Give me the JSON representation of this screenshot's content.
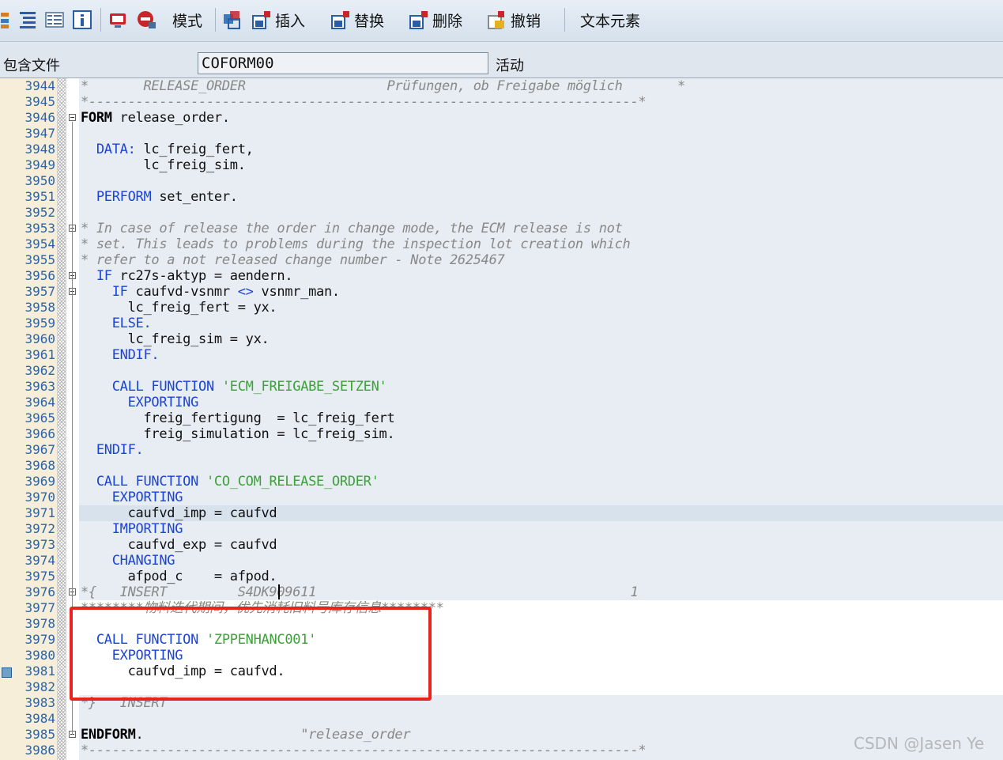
{
  "toolbar": {
    "mode_label": "模式",
    "insert_label": "插入",
    "replace_label": "替换",
    "delete_label": "删除",
    "undo_label": "撤销",
    "text_element_label": "文本元素"
  },
  "include": {
    "label": "包含文件",
    "program": "COFORM00",
    "status": "活动"
  },
  "lines": [
    {
      "n": "3944",
      "parts": [
        {
          "t": "*       RELEASE_ORDER                  Prüfungen, ob Freigabe möglich       *",
          "c": "com"
        }
      ]
    },
    {
      "n": "3945",
      "parts": [
        {
          "t": "*----------------------------------------------------------------------*",
          "c": "com"
        }
      ]
    },
    {
      "n": "3946",
      "parts": [
        {
          "t": "FORM",
          "c": "bold"
        },
        {
          "t": " release_order.",
          "c": ""
        }
      ]
    },
    {
      "n": "3947",
      "parts": []
    },
    {
      "n": "3948",
      "parts": [
        {
          "t": "  DATA:",
          "c": "kw"
        },
        {
          "t": " lc_freig_fert,",
          "c": ""
        }
      ]
    },
    {
      "n": "3949",
      "parts": [
        {
          "t": "        lc_freig_sim.",
          "c": ""
        }
      ]
    },
    {
      "n": "3950",
      "parts": []
    },
    {
      "n": "3951",
      "parts": [
        {
          "t": "  PERFORM",
          "c": "kw"
        },
        {
          "t": " set_enter.",
          "c": ""
        }
      ]
    },
    {
      "n": "3952",
      "parts": []
    },
    {
      "n": "3953",
      "parts": [
        {
          "t": "* In case of release the order in change mode, the ECM release is not",
          "c": "com"
        }
      ]
    },
    {
      "n": "3954",
      "parts": [
        {
          "t": "* set. This leads to problems during the inspection lot creation which",
          "c": "com"
        }
      ]
    },
    {
      "n": "3955",
      "parts": [
        {
          "t": "* refer to a not released change number - Note 2625467",
          "c": "com"
        }
      ]
    },
    {
      "n": "3956",
      "parts": [
        {
          "t": "  IF",
          "c": "kw"
        },
        {
          "t": " rc27s-aktyp = aendern.",
          "c": ""
        }
      ]
    },
    {
      "n": "3957",
      "parts": [
        {
          "t": "    IF",
          "c": "kw"
        },
        {
          "t": " caufvd-vsnmr ",
          "c": ""
        },
        {
          "t": "<>",
          "c": "kw"
        },
        {
          "t": " vsnmr_man.",
          "c": ""
        }
      ]
    },
    {
      "n": "3958",
      "parts": [
        {
          "t": "      lc_freig_fert = yx.",
          "c": ""
        }
      ]
    },
    {
      "n": "3959",
      "parts": [
        {
          "t": "    ELSE.",
          "c": "kw"
        }
      ]
    },
    {
      "n": "3960",
      "parts": [
        {
          "t": "      lc_freig_sim = yx.",
          "c": ""
        }
      ]
    },
    {
      "n": "3961",
      "parts": [
        {
          "t": "    ENDIF.",
          "c": "kw"
        }
      ]
    },
    {
      "n": "3962",
      "parts": []
    },
    {
      "n": "3963",
      "parts": [
        {
          "t": "    CALL FUNCTION",
          "c": "kw"
        },
        {
          "t": " 'ECM_FREIGABE_SETZEN'",
          "c": "str"
        }
      ]
    },
    {
      "n": "3964",
      "parts": [
        {
          "t": "      EXPORTING",
          "c": "kw"
        }
      ]
    },
    {
      "n": "3965",
      "parts": [
        {
          "t": "        freig_fertigung  = lc_freig_fert",
          "c": ""
        }
      ]
    },
    {
      "n": "3966",
      "parts": [
        {
          "t": "        freig_simulation = lc_freig_sim.",
          "c": ""
        }
      ]
    },
    {
      "n": "3967",
      "parts": [
        {
          "t": "  ENDIF.",
          "c": "kw"
        }
      ]
    },
    {
      "n": "3968",
      "parts": []
    },
    {
      "n": "3969",
      "parts": [
        {
          "t": "  CALL FUNCTION",
          "c": "kw"
        },
        {
          "t": " 'CO_COM_RELEASE_ORDER'",
          "c": "str"
        }
      ]
    },
    {
      "n": "3970",
      "parts": [
        {
          "t": "    EXPORTING",
          "c": "kw"
        }
      ]
    },
    {
      "n": "3971",
      "parts": [
        {
          "t": "      caufvd_imp = caufvd",
          "c": ""
        }
      ]
    },
    {
      "n": "3972",
      "parts": [
        {
          "t": "    IMPORTING",
          "c": "kw"
        }
      ]
    },
    {
      "n": "3973",
      "parts": [
        {
          "t": "      caufvd_exp = caufvd",
          "c": ""
        }
      ]
    },
    {
      "n": "3974",
      "parts": [
        {
          "t": "    CHANGING",
          "c": "kw"
        }
      ]
    },
    {
      "n": "3975",
      "parts": [
        {
          "t": "      afpod_c    = afpod.",
          "c": ""
        }
      ]
    },
    {
      "n": "3976",
      "parts": [
        {
          "t": "*{   INSERT         S4DK909611                                        1",
          "c": "com"
        }
      ]
    },
    {
      "n": "3977",
      "parts": [
        {
          "t": "********物料迭代期间，优先消耗旧料号库存信息********",
          "c": "com"
        }
      ]
    },
    {
      "n": "3978",
      "parts": []
    },
    {
      "n": "3979",
      "parts": [
        {
          "t": "  CALL FUNCTION",
          "c": "kw"
        },
        {
          "t": " 'ZPPENHANC001'",
          "c": "str"
        }
      ]
    },
    {
      "n": "3980",
      "parts": [
        {
          "t": "    EXPORTING",
          "c": "kw"
        }
      ]
    },
    {
      "n": "3981",
      "parts": [
        {
          "t": "      caufvd_imp = caufvd.",
          "c": ""
        }
      ]
    },
    {
      "n": "3982",
      "parts": []
    },
    {
      "n": "3983",
      "parts": [
        {
          "t": "*}   INSERT",
          "c": "com"
        }
      ]
    },
    {
      "n": "3984",
      "parts": []
    },
    {
      "n": "3985",
      "parts": [
        {
          "t": "ENDFORM",
          "c": "bold"
        },
        {
          "t": ".                    ",
          "c": ""
        },
        {
          "t": "\"release_order",
          "c": "com"
        }
      ]
    },
    {
      "n": "3986",
      "parts": [
        {
          "t": "*----------------------------------------------------------------------*",
          "c": "com"
        }
      ]
    }
  ],
  "watermark": "CSDN @Jasen Ye"
}
